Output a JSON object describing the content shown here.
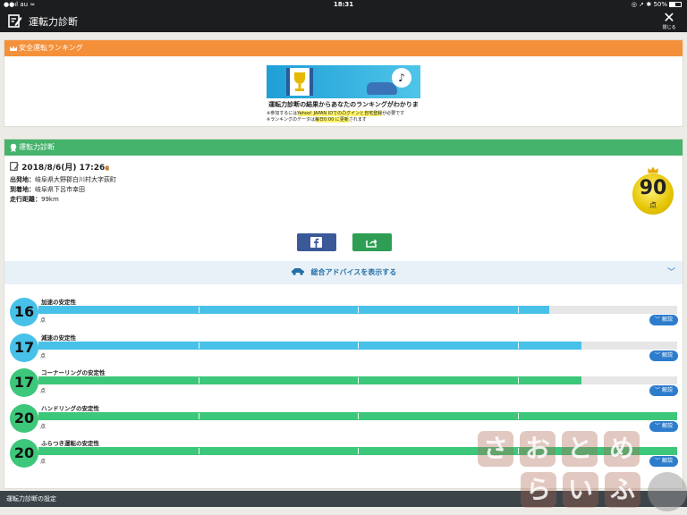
{
  "status_bar": {
    "carrier": "au",
    "time": "18:31",
    "battery": "50%",
    "battery_level": 0.5
  },
  "app": {
    "title": "運転力診断",
    "close_label": "閉じる"
  },
  "ranking": {
    "header": "安全運転ランキング",
    "banner_main": "運転力診断の結果からあなたのランキングがわかります",
    "banner_note1_pre": "※参加するには",
    "banner_note1_hl": "Yahoo! JAPAN IDでのログインと自宅登録",
    "banner_note1_post": "が必要です",
    "banner_note2_pre": "※ランキングのデータは",
    "banner_note2_hl": "毎日0:00 に更新",
    "banner_note2_post": "されます"
  },
  "diagnosis": {
    "header": "運転力診断",
    "date": "2018/8/6(月) 17:26",
    "date_suffix": "着",
    "origin_label": "出発地：",
    "origin": "岐阜県大野郡白川村大字荻町",
    "destination_label": "到着地：",
    "destination": "岐阜県下呂市幸田",
    "distance_label": "走行距離：",
    "distance": "99km",
    "score": "90",
    "score_unit": "点",
    "advice_label": "総合アドバイスを表示する"
  },
  "metrics": [
    {
      "score": "16",
      "label": "加速の安定性",
      "unit": "点",
      "help": "解説",
      "color": "#47c1e8",
      "fraction": 0.8
    },
    {
      "score": "17",
      "label": "減速の安定性",
      "unit": "点",
      "help": "解説",
      "color": "#47c1e8",
      "fraction": 0.85
    },
    {
      "score": "17",
      "label": "コーナーリングの安定性",
      "unit": "点",
      "help": "解説",
      "color": "#3dc77a",
      "fraction": 0.85
    },
    {
      "score": "20",
      "label": "ハンドリングの安定性",
      "unit": "点",
      "help": "解説",
      "color": "#3dc77a",
      "fraction": 1.0
    },
    {
      "score": "20",
      "label": "ふらつき運転の安定性",
      "unit": "点",
      "help": "解説",
      "color": "#3dc77a",
      "fraction": 1.0
    }
  ],
  "settings_label": "運転力診断の設定",
  "watermark": [
    "さ",
    "お",
    "と",
    "め",
    "ら",
    "い",
    "ふ"
  ]
}
